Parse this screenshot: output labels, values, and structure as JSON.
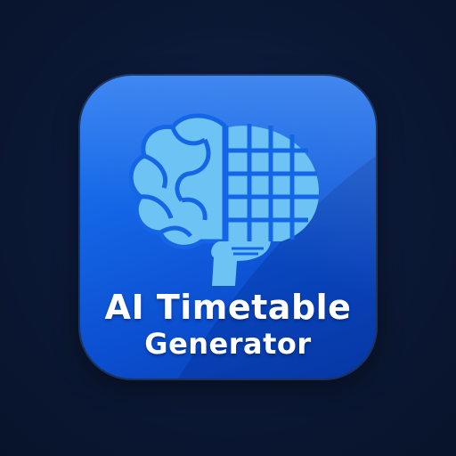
{
  "app_icon": {
    "title_line_1": "AI Timetable",
    "title_line_2": "Generator",
    "icon_name": "brain-grid-icon",
    "colors": {
      "background": "#0b1834",
      "tile": "#1466e6",
      "brain": "#6ec3f5",
      "text": "#ffffff"
    }
  }
}
